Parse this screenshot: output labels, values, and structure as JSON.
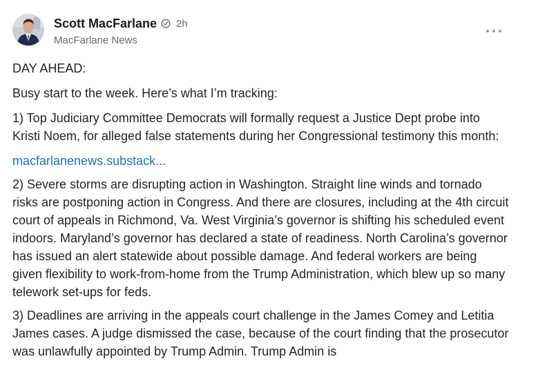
{
  "author": {
    "name": "Scott MacFarlane",
    "verified_icon": "verified-check-icon",
    "timestamp": "2h",
    "publication": "MacFarlane News"
  },
  "menu": {
    "icon": "more-horizontal-icon"
  },
  "post": {
    "heading": "DAY AHEAD:",
    "intro": "Busy start to the week.  Here’s what I’m tracking:",
    "item1": "1)   Top Judiciary Committee Democrats will formally request a Justice Dept probe into Kristi Noem, for alleged false statements during her Congressional testimony this month:",
    "link": "macfarlanenews.substack...",
    "item2": "2)  Severe storms are disrupting action in Washington.   Straight line winds and tornado risks are postponing action in Congress.    And there are closures, including at the 4th circuit court of appeals in Richmond, Va.    West Virginia’s governor is shifting his scheduled event indoors.    Maryland’s governor has declared a state of readiness.  North Carolina’s governor has issued an alert statewide about possible damage.       And federal workers are being given flexibility to work-from-home from the Trump Administration, which blew up so many telework set-ups for feds.",
    "item3": "3)  Deadlines are arriving in the appeals court challenge in the James Comey and Letitia James cases.    A judge dismissed the case, because of the court finding that the prosecutor was unlawfully appointed by Trump Admin.    Trump Admin is"
  },
  "colors": {
    "text": "#242424",
    "secondary": "#6b6b6b",
    "link": "#1a73b5"
  }
}
